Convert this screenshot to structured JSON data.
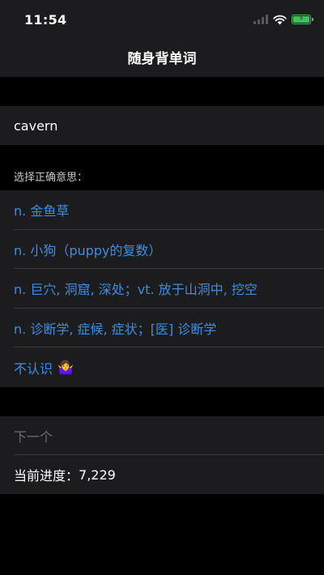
{
  "status": {
    "time": "11:54"
  },
  "nav": {
    "title": "随身背单词"
  },
  "word": "cavern",
  "section_label": "选择正确意思：",
  "options": [
    "n. 金鱼草",
    "n. 小狗（puppy的复数）",
    "n. 巨穴, 洞窟, 深处；vt. 放于山洞中, 挖空",
    "n. 诊断学, 症候, 症状；[医] 诊断学"
  ],
  "unknown": {
    "label": "不认识",
    "emoji": "🤷‍♀️"
  },
  "next_label": "下一个",
  "progress": {
    "label": "当前进度：",
    "value": "7,229"
  },
  "colors": {
    "background": "#000000",
    "cell": "#1c1c1e",
    "link": "#3a8ee6",
    "battery": "#34c759"
  },
  "icons": [
    "signal-icon",
    "wifi-icon",
    "battery-charging-icon"
  ]
}
